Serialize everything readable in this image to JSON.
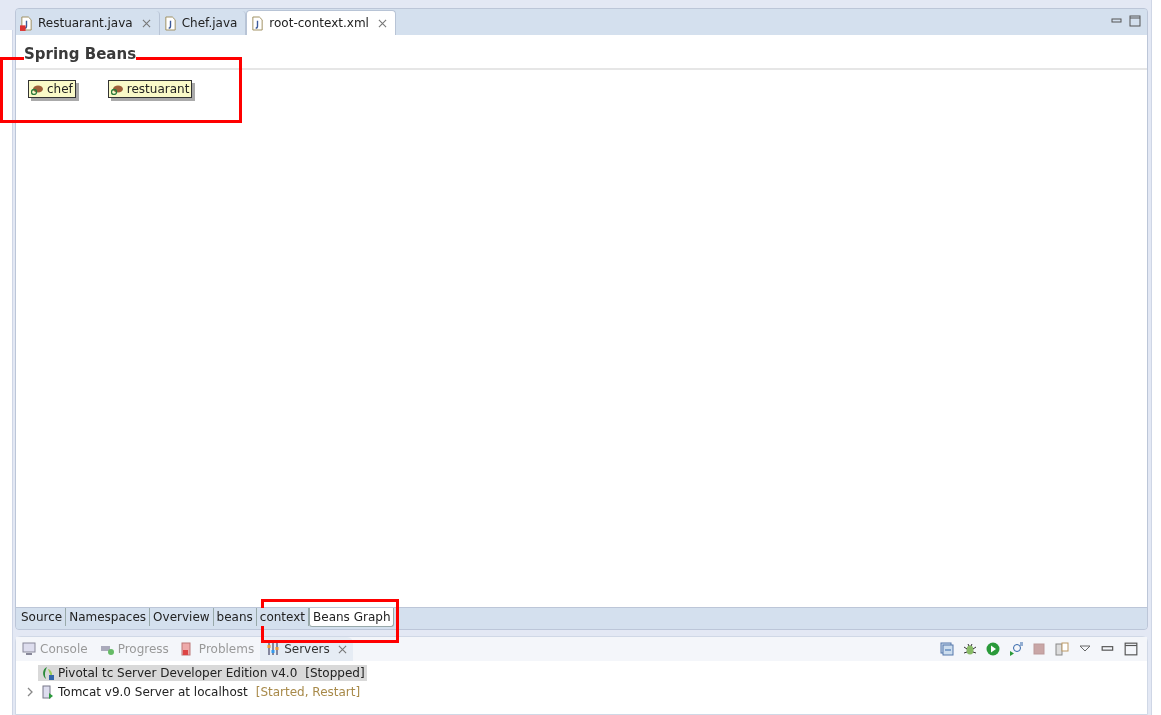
{
  "editor_tabs": [
    {
      "label": "Restuarant.java",
      "selected": false,
      "error": true,
      "closable": true
    },
    {
      "label": "Chef.java",
      "selected": false,
      "error": false,
      "closable": false
    },
    {
      "label": "root-context.xml",
      "selected": true,
      "error": false,
      "closable": true
    }
  ],
  "editor": {
    "title": "Spring Beans",
    "beans": [
      {
        "name": "chef"
      },
      {
        "name": "restuarant"
      }
    ]
  },
  "page_tabs": [
    {
      "label": "Source",
      "selected": false
    },
    {
      "label": "Namespaces",
      "selected": false
    },
    {
      "label": "Overview",
      "selected": false
    },
    {
      "label": "beans",
      "selected": false
    },
    {
      "label": "context",
      "selected": false
    },
    {
      "label": "Beans Graph",
      "selected": true
    }
  ],
  "view_tabs": [
    {
      "label": "Console",
      "kind": "console",
      "selected": false
    },
    {
      "label": "Progress",
      "kind": "progress",
      "selected": false
    },
    {
      "label": "Problems",
      "kind": "problems",
      "selected": false
    },
    {
      "label": "Servers",
      "kind": "servers",
      "selected": true
    }
  ],
  "servers": [
    {
      "name": "Pivotal tc Server Developer Edition v4.0",
      "status": "[Stopped]",
      "selected": true,
      "expandable": false
    },
    {
      "name": "Tomcat v9.0 Server at localhost",
      "status": "[Started, Restart]",
      "selected": false,
      "expandable": true
    }
  ]
}
